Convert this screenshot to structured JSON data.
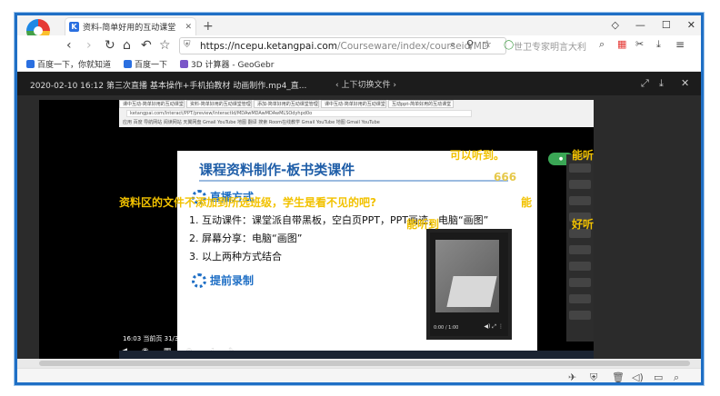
{
  "browser": {
    "tab_title": "资料-简单好用的互动课堂",
    "tab_icon_letter": "K",
    "new_tab": "+",
    "window_controls": [
      "◇",
      "—",
      "☐",
      "✕"
    ],
    "url_scheme": "https://",
    "url_host": "ncepu.ketangpai.com",
    "url_path": "/Courseware/index/courseid/MD",
    "search_placeholder": "世卫专家明言大利"
  },
  "bookmarks": [
    {
      "label": "百度一下，你就知道",
      "color": "#2a6fe0"
    },
    {
      "label": "百度一下",
      "color": "#2a6fe0"
    },
    {
      "label": "3D 计算器 - GeoGebr",
      "color": "#7b57c9"
    }
  ],
  "video_bar": {
    "title": "2020-02-10 16:12 第三次直播 基本操作+手机拍教材 动画制作.mp4_直...",
    "switch_label": "上下切换文件"
  },
  "inner_browser": {
    "tabs": [
      "课中互动-简单好用的互动课堂",
      "资料-简单好用的互动课堂管理",
      "添加-简单好用的互动课堂管理",
      "课中互动-简单好用的互动课堂",
      "互动ppt-简单好用的互动课堂"
    ],
    "url": "ketangpai.com/Interact/PPT/preview/InteractId/MDAwMDAwMDAwMLSOdyhpd0o",
    "bookmarks": "应用  百度  导航网站  阅读网站  天翼网盘  Gmail  YouTube  地图  翻译  搜索  Room在线教学  Gmail  YouTube  地图  Gmail  YouTube"
  },
  "slide": {
    "title": "课程资料制作-板书类课件",
    "section1": "直播方式",
    "items": [
      "1. 互动课件：课堂派自带黑板，空白页PPT，PPT画迹，电脑“画图”",
      "2. 屏幕分享：电脑“画图”",
      "3. 以上两种方式结合"
    ],
    "section2": "提前录制",
    "video_time": "0:00 / 1:00"
  },
  "danmu": [
    "可以听到。",
    "能听",
    "666",
    "资料区的文件不添加到所选班级，学生是看不见的吧?",
    "能",
    "能听到",
    "好听"
  ],
  "page_indicator": "16:03  当前页 31/34",
  "inner_tools": [
    "◀",
    "◉",
    "▦",
    "⊕",
    "⤢",
    "✎"
  ]
}
